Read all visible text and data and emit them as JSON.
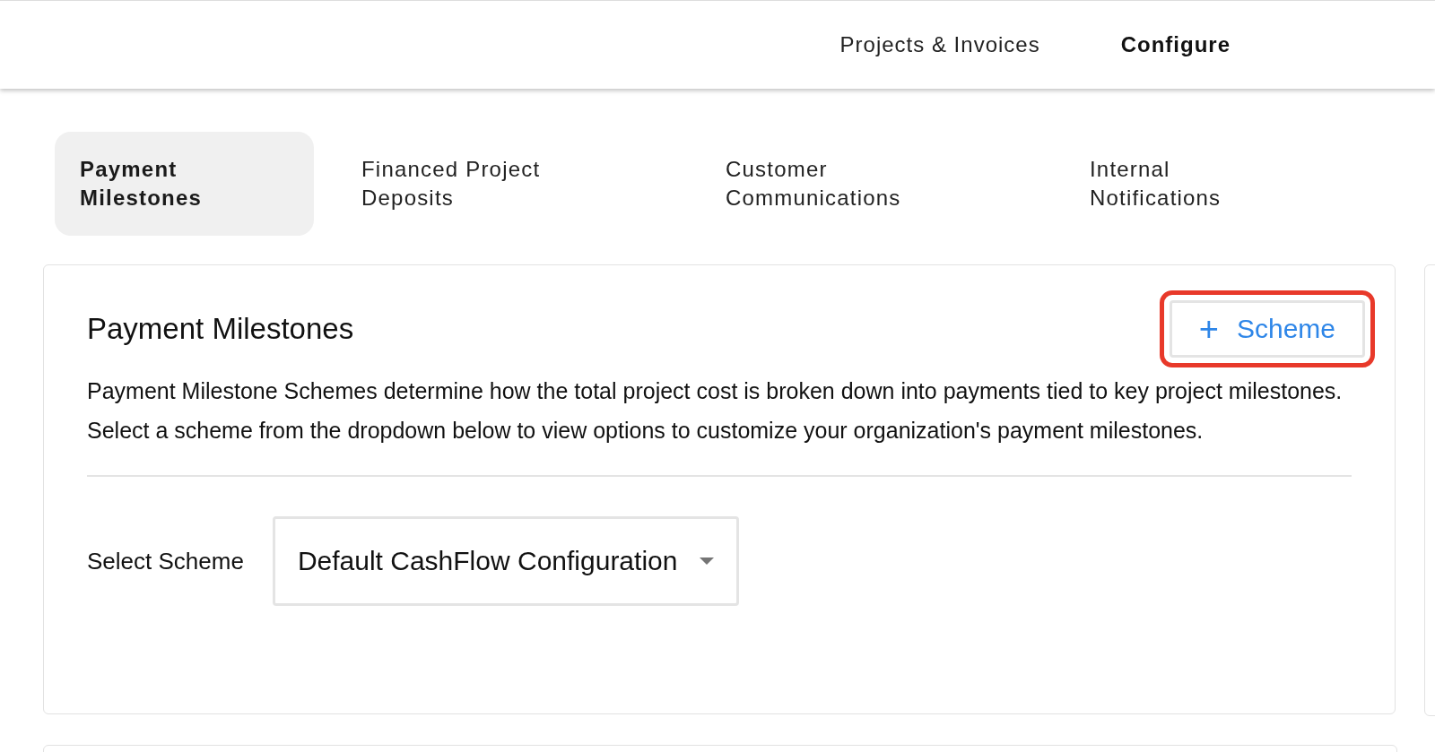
{
  "top_nav": {
    "items": [
      {
        "label": "Projects & Invoices",
        "selected": false
      },
      {
        "label": "Configure",
        "selected": true
      }
    ]
  },
  "tabs": [
    {
      "label": "Payment Milestones",
      "selected": true
    },
    {
      "label": "Financed Project Deposits",
      "selected": false
    },
    {
      "label": "Customer Communications",
      "selected": false
    },
    {
      "label": "Internal Notifications",
      "selected": false
    }
  ],
  "card": {
    "title": "Payment Milestones",
    "add_button": {
      "icon": "+",
      "label": "Scheme",
      "highlighted": true
    },
    "paragraphs": [
      "Payment Milestone Schemes determine how the total project cost is broken down into payments tied to key project milestones.",
      "Select a scheme from the dropdown below to view options to customize your organization's payment milestones."
    ],
    "select": {
      "label": "Select Scheme",
      "value": "Default CashFlow Configuration"
    }
  }
}
